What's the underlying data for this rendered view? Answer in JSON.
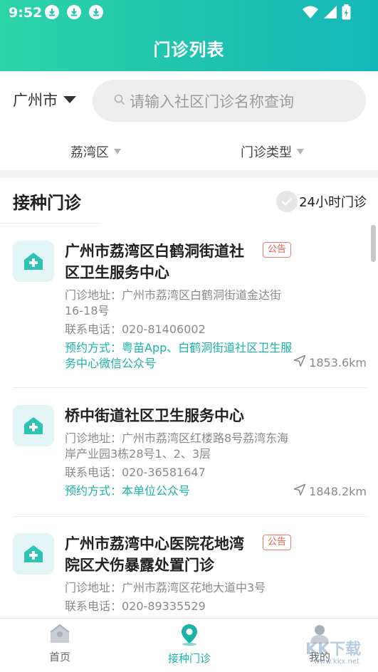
{
  "status_bar": {
    "time": "9:52",
    "download_icons": [
      "download-icon",
      "download-icon",
      "download-icon"
    ],
    "right_icons": [
      "wifi-icon",
      "signal-icon",
      "battery-charging-icon"
    ]
  },
  "header": {
    "title": "门诊列表"
  },
  "search": {
    "city": "广州市",
    "placeholder": "请输入社区门诊名称查询"
  },
  "filters": {
    "district": "荔湾区",
    "type": "门诊类型"
  },
  "section": {
    "title": "接种门诊",
    "toggle_label": "24小时门诊"
  },
  "clinics": [
    {
      "name": "广州市荔湾区白鹤洞街道社区卫生服务中心",
      "badge": "公告",
      "address": "门诊地址：广州市荔湾区白鹤洞街道金达街16-18号",
      "phone": "联系电话：020-81406002",
      "booking": "预约方式：粤苗App、白鹤洞街道社区卫生服务中心微信公众号",
      "distance": "1853.6km"
    },
    {
      "name": "桥中街道社区卫生服务中心",
      "badge": "",
      "address": "门诊地址：广州市荔湾区红楼路8号荔湾东海岸产业园3栋28号1、2、3层",
      "phone": "联系电话：020-36581647",
      "booking": "预约方式：本单位公众号",
      "distance": "1848.2km"
    },
    {
      "name": "广州市荔湾中心医院花地湾院区犬伤暴露处置门诊",
      "badge": "公告",
      "address": "门诊地址：广州市荔湾区花地大道中3号",
      "phone": "联系电话：020-89335529"
    }
  ],
  "tabbar": {
    "items": [
      {
        "label": "首页",
        "icon": "home-icon"
      },
      {
        "label": "接种门诊",
        "icon": "location-pin-icon"
      },
      {
        "label": "我的",
        "icon": "user-icon"
      }
    ],
    "active_index": 1
  },
  "watermark": {
    "text": "KK下载",
    "url": "www.kkx.net"
  },
  "colors": {
    "brand_gradient_start": "#2dd4a8",
    "brand_gradient_end": "#14b8b8",
    "accent_teal": "#1bb3a8",
    "notice_red": "#ef5a47"
  }
}
